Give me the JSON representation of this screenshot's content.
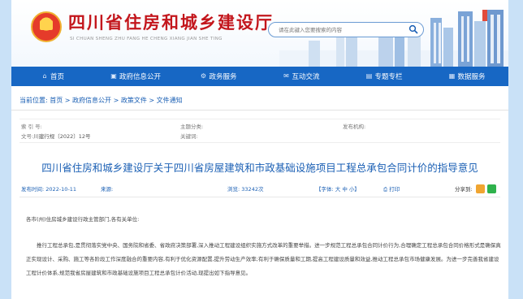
{
  "header": {
    "site_title": "四川省住房和城乡建设厅",
    "site_pinyin": "SI CHUAN SHENG ZHU FANG HE CHENG XIANG JIAN SHE TING",
    "search_placeholder": "请在此键入您要搜索的内容"
  },
  "nav": [
    {
      "label": "首页",
      "icon": "home-icon",
      "glyph": "⌂"
    },
    {
      "label": "政府信息公开",
      "icon": "document-icon",
      "glyph": "▣"
    },
    {
      "label": "政务服务",
      "icon": "service-icon",
      "glyph": "⚙"
    },
    {
      "label": "互动交流",
      "icon": "chat-icon",
      "glyph": "✉"
    },
    {
      "label": "专题专栏",
      "icon": "column-icon",
      "glyph": "▤"
    },
    {
      "label": "数据服务",
      "icon": "data-icon",
      "glyph": "▦"
    }
  ],
  "breadcrumb": {
    "prefix": "当前位置:",
    "items": [
      "首页",
      "政府信息公开",
      "政策文件",
      "文件通知"
    ],
    "sep": " > "
  },
  "meta": {
    "index_label": "索 引 号:",
    "index_value": "",
    "doc_no_label": "文号:",
    "doc_no_value": "川建行规〔2022〕12号",
    "category_label": "主题分类:",
    "category_value": "",
    "keywords_label": "关键词:",
    "keywords_value": "",
    "publisher_label": "发布机构:",
    "publisher_value": ""
  },
  "article": {
    "title": "四川省住房和城乡建设厅关于四川省房屋建筑和市政基础设施项目工程总承包合同计价的指导意见",
    "date_label": "发布时间:",
    "date": "2022-10-11",
    "source_label": "来源:",
    "views_label": "浏览:",
    "views": "33242次",
    "font_size_label": "【字体: 大 中 小】",
    "print_label": "打印",
    "share_label": "分享到:",
    "greeting": "各市(州)住房城乡建设行政主管部门,各有关单位:",
    "paragraph1": "推行工程总承包,是贯彻落实党中央、国务院和省委、省政府决策部署,深入推动工程建设组织实施方式改革的重要举措。进一步规范工程总承包合同计价行为,合理确定工程总承包合同价格形式是确保真正实现设计、采购、施工等各阶段工作深度融合的重要内容,有利于优化资源配置,提升劳动生产效率;有利于确保质量和工期,提高工程建设质量和效益,推动工程总承包市场健康发展。为进一步完善我省建设工程计价体系,规范我省房屋建筑和市政基础设施项目工程总承包计价活动,现提出如下指导意见。"
  },
  "colors": {
    "brand_red": "#c3161c",
    "nav_blue": "#1767c4",
    "link_blue": "#1a5fb4",
    "background": "#c9e1f7"
  }
}
